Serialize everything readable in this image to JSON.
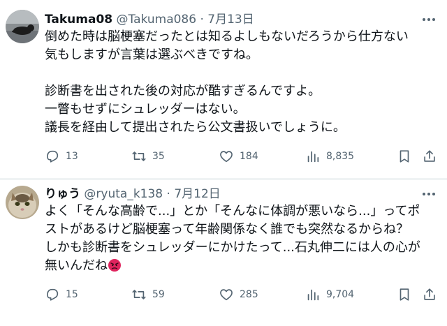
{
  "tweets": [
    {
      "name": "Takuma08",
      "handle": "@Takuma086",
      "sep": "·",
      "date": "7月13日",
      "lines": [
        "倒めた時は脳梗塞だったとは知るよしもないだろうから仕方ない",
        "気もしますが言葉は選ぶべきですね。",
        "",
        "診断書を出された後の対応が酷すぎるんですよ。",
        "一瞥もせずにシュレッダーはない。",
        "議長を経由して提出されたら公文書扱いでしょうに。"
      ],
      "replies": "13",
      "reposts": "35",
      "likes": "184",
      "views": "8,835",
      "avatar_icon": "cat-photo-avatar"
    },
    {
      "name": "りゅう",
      "handle": "@ryuta_k138",
      "sep": "·",
      "date": "7月12日",
      "lines": [
        "よく「そんな高齢で...」とか「そんなに体調が悪いなら...」ってポ",
        "ストがあるけど脳梗塞って年齢関係なく誰でも突然なるからね？",
        "しかも診断書をシュレッダーにかけたって...石丸伸二には人の心が",
        "無いんだね"
      ],
      "emoji": "angry-face-emoji",
      "replies": "15",
      "reposts": "59",
      "likes": "285",
      "views": "9,704",
      "avatar_icon": "cat-closeup-avatar"
    }
  ],
  "colors": {
    "text": "#0f1419",
    "muted": "#536471",
    "divider": "#eff3f4",
    "emoji_red": "#e0245e"
  },
  "icons": [
    "reply-icon",
    "repost-icon",
    "like-icon",
    "views-icon",
    "bookmark-icon",
    "share-icon",
    "more-icon"
  ]
}
